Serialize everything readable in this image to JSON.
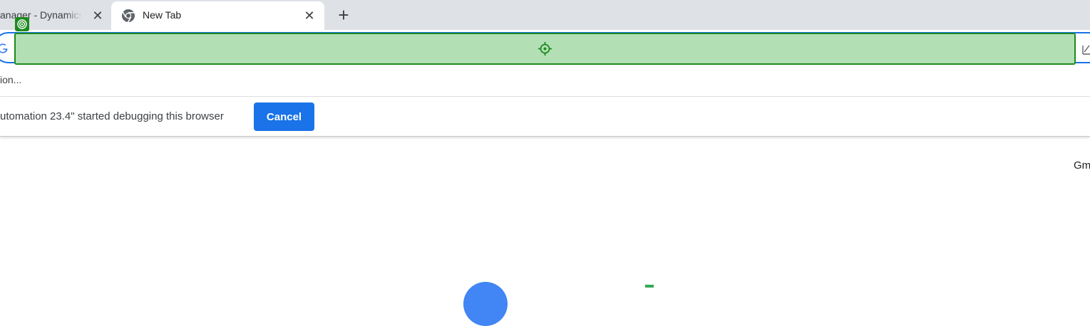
{
  "browser": {
    "tabs": [
      {
        "title": "anager - Dynamics",
        "active": false,
        "close_glyph": "✕",
        "favicon": "none"
      },
      {
        "title": "New Tab",
        "active": true,
        "close_glyph": "✕",
        "favicon": "chrome-icon"
      }
    ],
    "new_tab_glyph": "+",
    "omnibox": {
      "value": "",
      "leading_icon": "google-g-icon",
      "trailing_icon": "edit-icon"
    },
    "bookmark_bar": {
      "text": "ion..."
    },
    "infobar": {
      "message": "utomation 23.4\" started debugging this browser",
      "cancel_label": "Cancel"
    }
  },
  "overlay": {
    "highlight_color": "#b3dfb5",
    "border_color": "#1e8a1e",
    "target_icon": "crosshair-icon",
    "marker_icon": "target-marker-icon"
  },
  "new_tab_page": {
    "top_link": "Gm"
  },
  "colors": {
    "accent": "#1a73e8",
    "tabstrip_bg": "#dee1e6"
  }
}
